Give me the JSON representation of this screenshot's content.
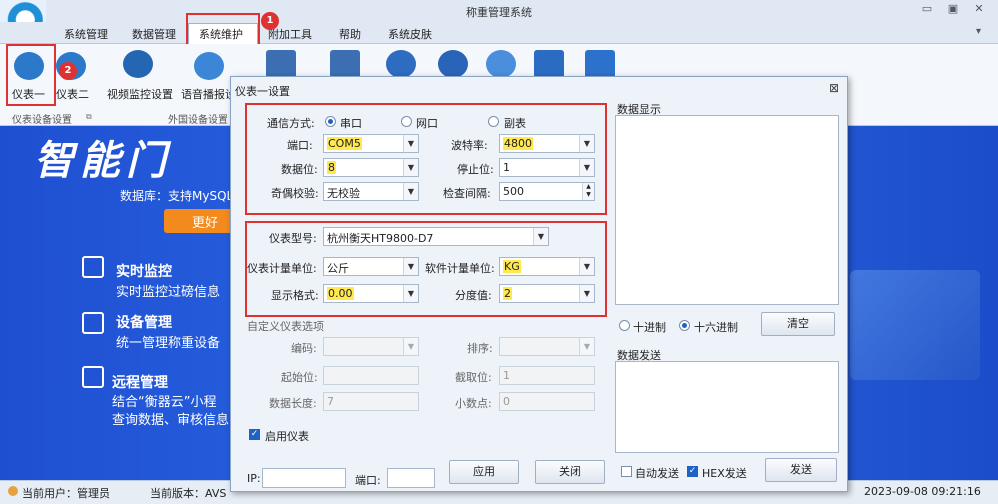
{
  "app": {
    "title": "称重管理系统"
  },
  "menu": [
    "系统管理",
    "数据管理",
    "系统维护",
    "附加工具",
    "帮助",
    "系统皮肤"
  ],
  "ribbon": {
    "meter1": "仪表一",
    "meter2": "仪表二",
    "video": "视频监控设置",
    "voice": "语音播报设",
    "group1": "仪表设备设置",
    "group2": "外国设备设置"
  },
  "badges": {
    "b1": "1",
    "b2": "2"
  },
  "background": {
    "banner": "智能门",
    "db_line": "数据库：支持MySQL、",
    "more_btn": "更好",
    "features": [
      {
        "title": "实时监控",
        "desc": "实时监控过磅信息"
      },
      {
        "title": "设备管理",
        "desc": "统一管理称重设备"
      },
      {
        "title": "远程管理",
        "desc": "结合“衡器云”小程",
        "desc2": "查询数据、审核信息"
      }
    ]
  },
  "status": {
    "user": "当前用户：管理员",
    "version": "当前版本：AVS",
    "datetime": "2023-09-08 09:21:16"
  },
  "dialog": {
    "title": "仪表一设置",
    "comm_label": "通信方式:",
    "comm_options": [
      "串口",
      "网口",
      "副表"
    ],
    "port_label": "端口:",
    "port": "COM5",
    "baud_label": "波特率:",
    "baud": "4800",
    "databits_label": "数据位:",
    "databits": "8",
    "stopbits_label": "停止位:",
    "stopbits": "1",
    "parity_label": "奇偶校验:",
    "parity": "无校验",
    "interval_label": "检查间隔:",
    "interval": "500",
    "model_label": "仪表型号:",
    "model": "杭州衡天HT9800-D7",
    "meter_unit_label": "仪表计量单位:",
    "meter_unit": "公斤",
    "soft_unit_label": "软件计量单位:",
    "soft_unit": "KG",
    "format_label": "显示格式:",
    "format": "0.00",
    "division_label": "分度值:",
    "division": "2",
    "custom_label": "自定义仪表选项",
    "code_label": "编码:",
    "sort_label": "排序:",
    "start_label": "起始位:",
    "cut_label": "截取位:",
    "cut_value": "1",
    "len_label": "数据长度:",
    "len_value": "7",
    "decimal_label": "小数点:",
    "decimal_value": "0",
    "enable_label": "启用仪表",
    "ip_label": "IP:",
    "dport_label": "端口:",
    "apply": "应用",
    "close": "关闭",
    "data_display": "数据显示",
    "dec_label": "十进制",
    "hex_label": "十六进制",
    "clear": "清空",
    "data_send": "数据发送",
    "auto_send": "自动发送",
    "hex_send": "HEX发送",
    "send": "发送"
  }
}
